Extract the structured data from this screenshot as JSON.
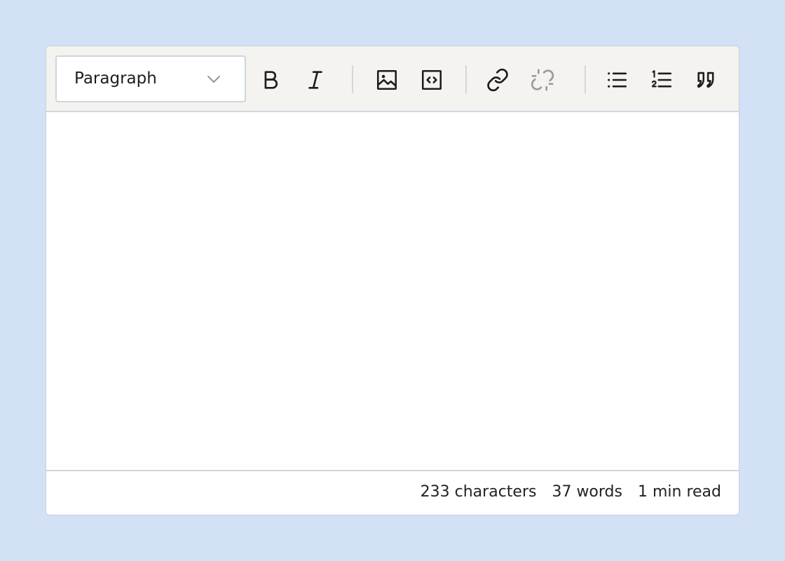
{
  "colors": {
    "background": "#d3e1f6",
    "toolbar": "#f4f3ef",
    "icon": "#1d1d1d",
    "icon_disabled": "#9a9a9a",
    "border": "#cfd6df"
  },
  "toolbar": {
    "block_select": {
      "value": "Paragraph",
      "icon": "chevron-down-icon"
    },
    "buttons": [
      {
        "id": "bold",
        "icon": "bold-icon",
        "enabled": true
      },
      {
        "id": "italic",
        "icon": "italic-icon",
        "enabled": true
      },
      {
        "id": "image",
        "icon": "image-icon",
        "enabled": true
      },
      {
        "id": "embed",
        "icon": "code-embed-icon",
        "enabled": true
      },
      {
        "id": "link",
        "icon": "link-icon",
        "enabled": true
      },
      {
        "id": "unlink",
        "icon": "unlink-icon",
        "enabled": false
      },
      {
        "id": "bullet-list",
        "icon": "bullet-list-icon",
        "enabled": true
      },
      {
        "id": "numbered-list",
        "icon": "numbered-list-icon",
        "enabled": true
      },
      {
        "id": "blockquote",
        "icon": "quote-icon",
        "enabled": true
      }
    ]
  },
  "footer": {
    "characters": "233 characters",
    "words": "37 words",
    "read_time": "1 min read"
  }
}
